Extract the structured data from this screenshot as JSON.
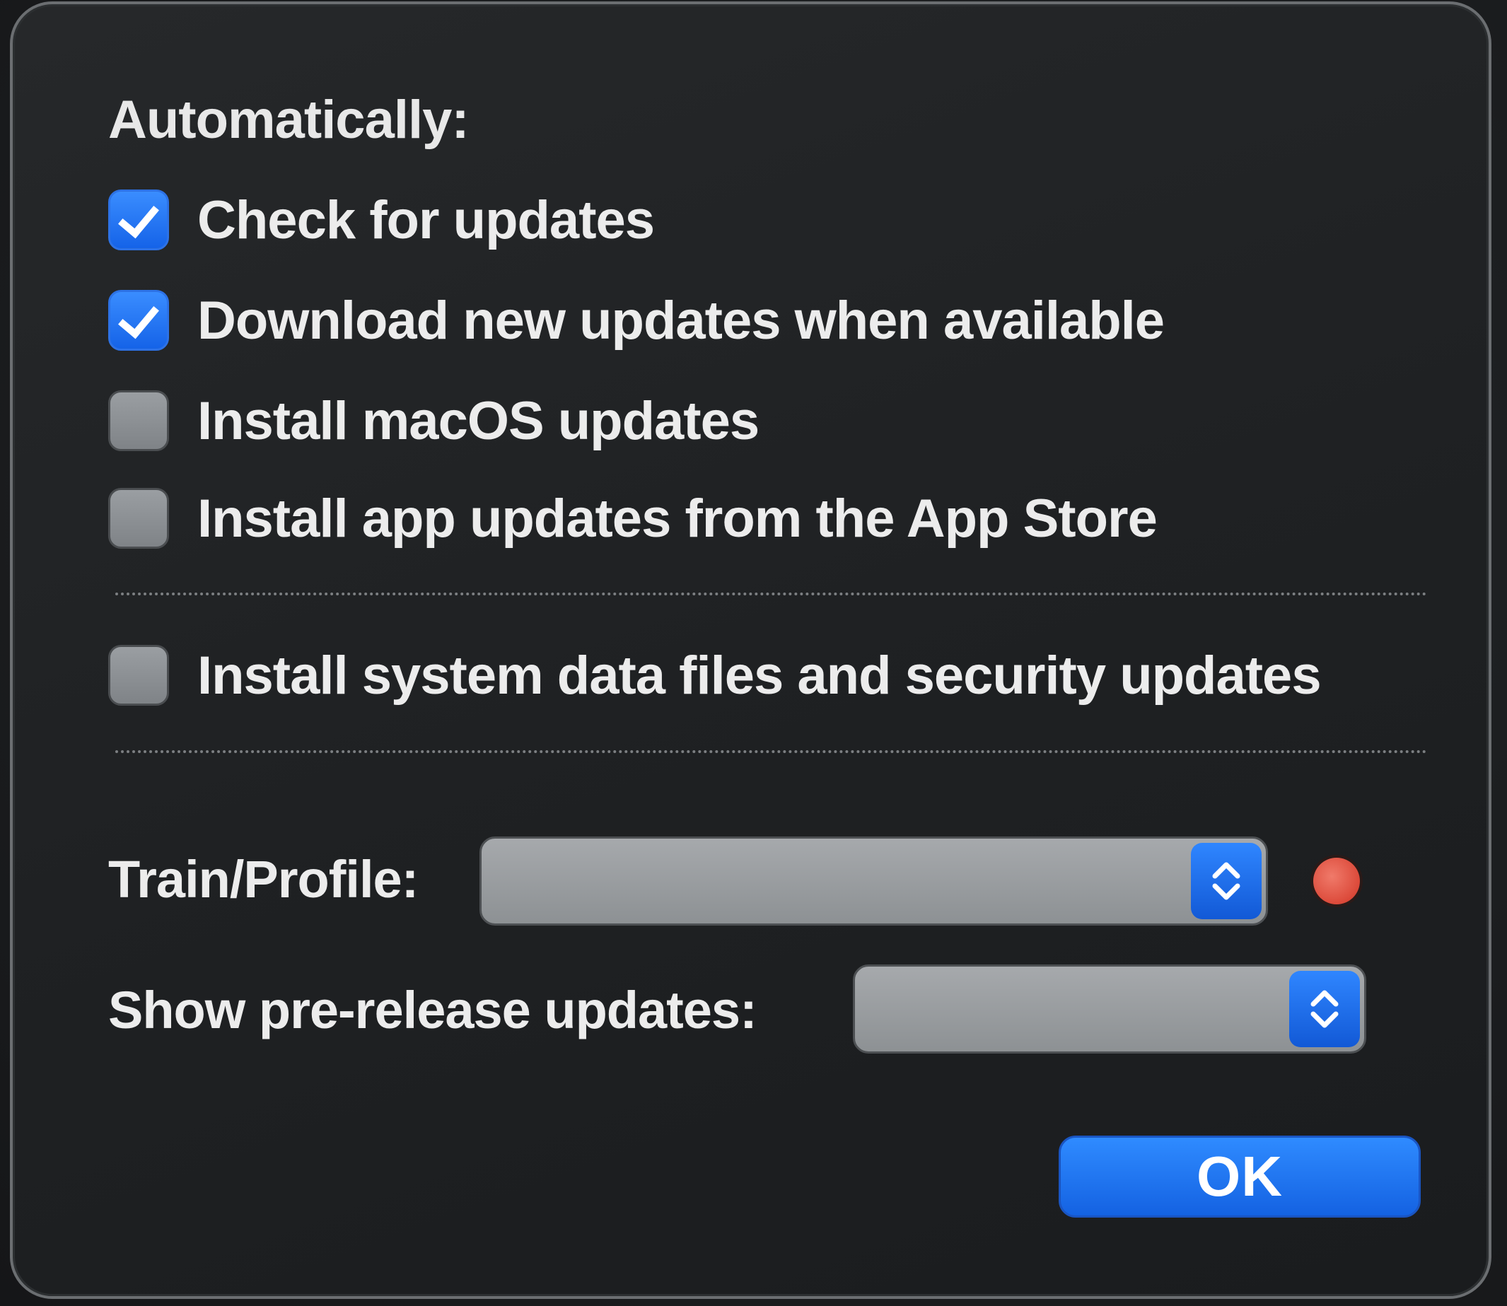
{
  "dialog": {
    "section_heading": "Automatically:",
    "options": [
      {
        "label": "Check for updates",
        "checked": true
      },
      {
        "label": "Download new updates when available",
        "checked": true
      },
      {
        "label": "Install macOS updates",
        "checked": false
      },
      {
        "label": "Install app updates from the App Store",
        "checked": false
      }
    ],
    "security_option": {
      "label": "Install system data files and security updates",
      "checked": false
    },
    "train_profile": {
      "label": "Train/Profile:",
      "value": "",
      "status_color": "#dc4a3a"
    },
    "prerelease": {
      "label": "Show pre-release updates:",
      "value": ""
    },
    "ok_label": "OK"
  },
  "colors": {
    "accent": "#1563e8",
    "checkbox_unchecked": "#8d9194",
    "background": "#1f2123",
    "status_dot": "#dc4a3a"
  },
  "icons": {
    "checkmark": "checkmark-icon",
    "stepper": "up-down-chevron-icon"
  }
}
